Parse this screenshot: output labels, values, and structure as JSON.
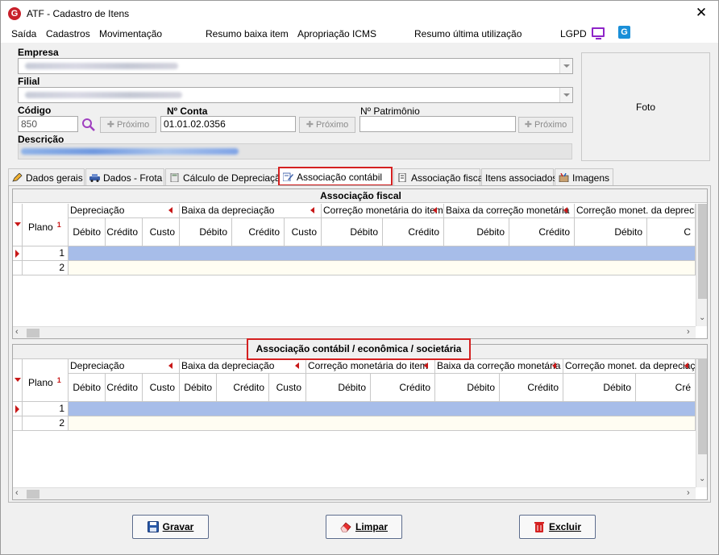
{
  "window": {
    "title": "ATF - Cadastro de Itens",
    "close_glyph": "✕"
  },
  "menu": {
    "items": [
      "Saída",
      "Cadastros",
      "Movimentação",
      "Resumo baixa item",
      "Apropriação ICMS",
      "Resumo última utilização",
      "LGPD"
    ]
  },
  "form": {
    "empresa_label": "Empresa",
    "filial_label": "Filial",
    "codigo_label": "Código",
    "codigo_value": "850",
    "proximo_label": "Próximo",
    "nconta_label": "Nº Conta",
    "nconta_value": "01.01.02.0356",
    "npatrimonio_label": "Nº Patrimônio",
    "npatrimonio_value": "",
    "descricao_label": "Descrição",
    "foto_label": "Foto"
  },
  "tabs": [
    {
      "label": "Dados gerais",
      "icon": "pencil-icon"
    },
    {
      "label": "Dados - Frota",
      "icon": "car-icon"
    },
    {
      "label": "Cálculo de Depreciação",
      "icon": "calculator-icon"
    },
    {
      "label": "Associação contábil",
      "icon": "edit-document-icon",
      "active": true
    },
    {
      "label": "Associação fiscal",
      "icon": "document-icon"
    },
    {
      "label": "Itens associados",
      "icon": ""
    },
    {
      "label": "Imagens",
      "icon": "images-icon"
    }
  ],
  "grid_fiscal": {
    "caption": "Associação fiscal",
    "plano_header": "Plano",
    "groups": [
      "Depreciação",
      "Baixa da depreciação",
      "Correção monetária do item",
      "Baixa da correção monetária",
      "Correção monet. da depreciação"
    ],
    "subcols": [
      "Débito",
      "Crédito",
      "Custo",
      "Débito",
      "Crédito",
      "Custo",
      "Débito",
      "Crédito",
      "Débito",
      "Crédito",
      "Débito",
      "C"
    ],
    "rows": [
      "1",
      "2"
    ]
  },
  "grid_contabil": {
    "caption": "Associação contábil / econômica / societária",
    "plano_header": "Plano",
    "groups": [
      "Depreciação",
      "Baixa da depreciação",
      "Correção monetária do item",
      "Baixa da correção monetária",
      "Correção monet. da depreciação"
    ],
    "subcols": [
      "Débito",
      "Crédito",
      "Custo",
      "Débito",
      "Crédito",
      "Custo",
      "Débito",
      "Crédito",
      "Débito",
      "Crédito",
      "Débito",
      "Cré"
    ],
    "rows": [
      "1",
      "2"
    ]
  },
  "footer": {
    "gravar": "Gravar",
    "limpar": "Limpar",
    "excluir": "Excluir"
  },
  "colors": {
    "highlight_box": "#d42020",
    "selected_row": "#a7bde9",
    "lgpd_icon": "#8e24c8"
  }
}
